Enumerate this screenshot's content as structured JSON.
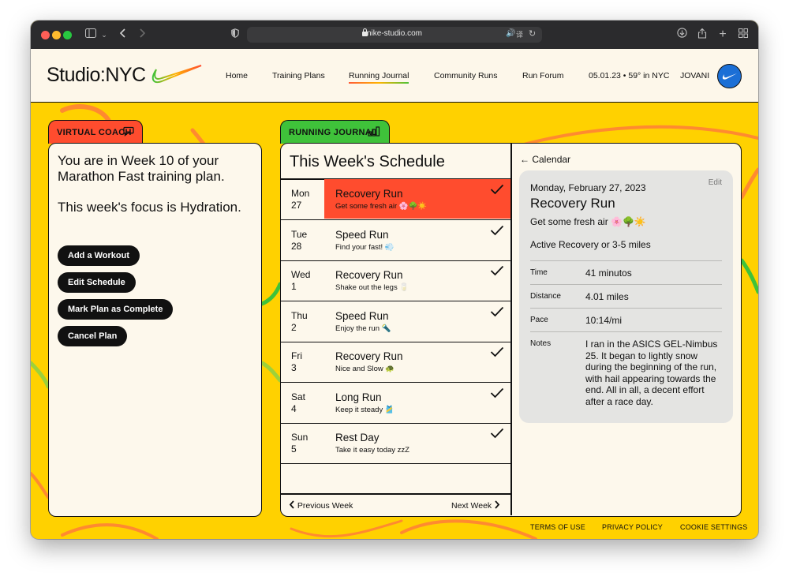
{
  "browser": {
    "url": "nike-studio.com"
  },
  "header": {
    "logo": "Studio:NYC",
    "nav": [
      "Home",
      "Training Plans",
      "Running Journal",
      "Community Runs",
      "Run Forum"
    ],
    "active_nav": "Running Journal",
    "date_weather": "05.01.23 • 59° in NYC",
    "user": "JOVANI"
  },
  "coach": {
    "tab_label": "VIRTUAL COACH",
    "week_text": "You are in Week 10 of your Marathon Fast training plan.",
    "focus_text": "This week's focus is Hydration.",
    "buttons": [
      "Add a Workout",
      "Edit Schedule",
      "Mark Plan as Complete",
      "Cancel Plan"
    ]
  },
  "journal": {
    "tab_label": "RUNNING JOURNAL",
    "title": "This Week's Schedule",
    "days": [
      {
        "day": "Mon",
        "date": "27",
        "title": "Recovery Run",
        "subtitle": "Get some fresh air 🌸🌳☀️",
        "done": true,
        "active": true
      },
      {
        "day": "Tue",
        "date": "28",
        "title": "Speed Run",
        "subtitle": "Find your fast! 💨",
        "done": true,
        "active": false
      },
      {
        "day": "Wed",
        "date": "1",
        "title": "Recovery Run",
        "subtitle": "Shake out the legs 🥛",
        "done": true,
        "active": false
      },
      {
        "day": "Thu",
        "date": "2",
        "title": "Speed Run",
        "subtitle": "Enjoy the run 🔦",
        "done": true,
        "active": false
      },
      {
        "day": "Fri",
        "date": "3",
        "title": "Recovery Run",
        "subtitle": "Nice and Slow 🐢",
        "done": true,
        "active": false
      },
      {
        "day": "Sat",
        "date": "4",
        "title": "Long Run",
        "subtitle": "Keep it steady 🎽",
        "done": true,
        "active": false
      },
      {
        "day": "Sun",
        "date": "5",
        "title": "Rest Day",
        "subtitle": "Take it easy today zzZ",
        "done": true,
        "active": false
      }
    ],
    "prev_week": "Previous Week",
    "next_week": "Next Week"
  },
  "detail": {
    "back_label": "Calendar",
    "edit_label": "Edit",
    "date": "Monday, February 27, 2023",
    "title": "Recovery Run",
    "subtitle": "Get some fresh air 🌸🌳☀️",
    "description": "Active Recovery or 3-5 miles",
    "fields": [
      {
        "label": "Time",
        "value": "41 minutos"
      },
      {
        "label": "Distance",
        "value": "4.01 miles"
      },
      {
        "label": "Pace",
        "value": "10:14/mi"
      },
      {
        "label": "Notes",
        "value": "I ran in the ASICS GEL-Nimbus 25. It began to lightly snow during the beginning of the run, with hail appearing towards the end. All in all, a decent effort after a race day."
      }
    ]
  },
  "footer": {
    "links": [
      "TERMS OF USE",
      "PRIVACY POLICY",
      "COOKIE SETTINGS"
    ]
  },
  "colors": {
    "background": "#ffd100",
    "coach_tab": "#ff4c2e",
    "journal_tab": "#3fc23a",
    "active_row": "#ff4c2e",
    "panel": "#fdf8ec"
  }
}
